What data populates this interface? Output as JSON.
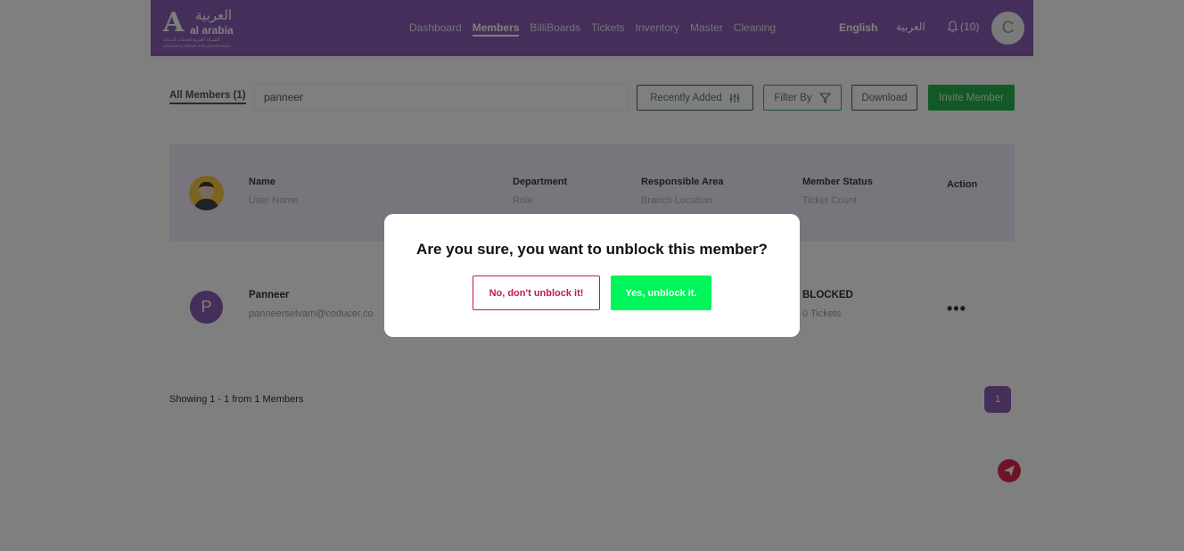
{
  "brand": {
    "logo_mark": "A",
    "logo_ar": "العربية",
    "logo_en": "al arabia",
    "logo_sub_ar": "الشركة العربية لخدمات الدعاية",
    "logo_sub_en": "ARABIAN COMPANY FOR ADVERTISING"
  },
  "nav": {
    "items": [
      "Dashboard",
      "Members",
      "BilliBoards",
      "Tickets",
      "Inventory",
      "Master",
      "Cleaning"
    ],
    "active": "Members"
  },
  "header": {
    "lang_en": "English",
    "lang_ar": "العربية",
    "notifications": "(10)",
    "user_initial": "C"
  },
  "toolbar": {
    "tab_all": "All Members (1)",
    "search_value": "panneer",
    "recently_added": "Recently Added",
    "filter_by": "Filter By",
    "download": "Download",
    "invite": "Invite Member"
  },
  "table": {
    "columns": [
      {
        "title": "Name",
        "sub": "User Name"
      },
      {
        "title": "Department",
        "sub": "Role"
      },
      {
        "title": "Responsible Area",
        "sub": "Branch Location"
      },
      {
        "title": "Member Status",
        "sub": "Ticket Count"
      },
      {
        "title": "Action",
        "sub": ""
      }
    ],
    "rows": [
      {
        "initial": "P",
        "name": "Panneer",
        "email": "panneerselvam@coducer.co",
        "status": "BLOCKED",
        "tickets": "0 Tickets",
        "action": "•••"
      }
    ]
  },
  "pagination": {
    "showing": "Showing 1 - 1 from 1 Members",
    "page": "1"
  },
  "modal": {
    "title": "Are you sure, you want to unblock this member?",
    "cancel_label": "No, don't unblock it!",
    "confirm_label": "Yes, unblock it."
  },
  "colors": {
    "primary": "#8a5fb5",
    "success": "#27b24f",
    "confirm": "#00f55a",
    "danger": "#c2185b"
  }
}
